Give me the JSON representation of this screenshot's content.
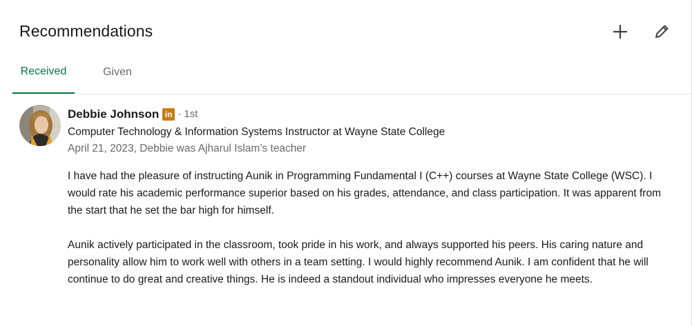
{
  "header": {
    "title": "Recommendations",
    "actions": [
      {
        "name": "add",
        "icon": "plus-icon"
      },
      {
        "name": "edit",
        "icon": "pencil-icon"
      }
    ]
  },
  "tabs": [
    {
      "label": "Received",
      "active": true
    },
    {
      "label": "Given",
      "active": false
    }
  ],
  "recommendation": {
    "name": "Debbie Johnson",
    "badge": "in",
    "degree": "· 1st",
    "headline": "Computer Technology & Information Systems Instructor at Wayne State College",
    "meta": "April 21, 2023, Debbie was Ajharul Islam’s teacher",
    "paragraphs": [
      "I have had the pleasure of instructing Aunik in Programming Fundamental I (C++) courses at Wayne State College (WSC). I would rate his academic performance superior based on his grades, attendance, and class participation. It was apparent from the start that he set the bar high for himself.",
      "Aunik actively participated in the classroom, took pride in his work, and always supported his peers. His caring nature and personality allow him to work well with others in a team setting. I would highly recommend Aunik. I am confident that he will continue to do great and creative things. He is indeed a standout individual who impresses everyone he meets."
    ]
  },
  "colors": {
    "accent": "#057642",
    "badge": "#c37d16",
    "muted_text": "#666666"
  }
}
